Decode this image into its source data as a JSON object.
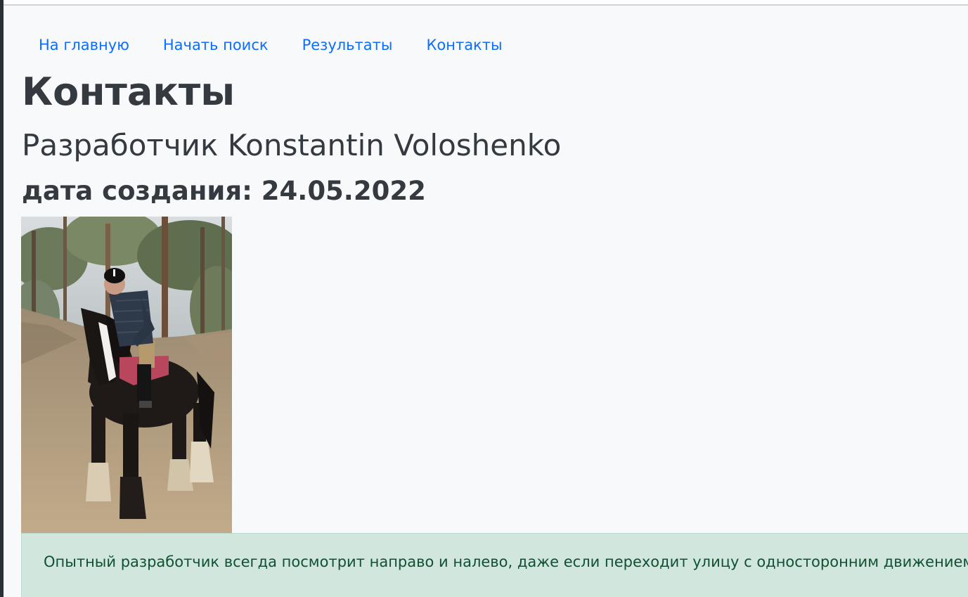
{
  "nav": {
    "items": [
      {
        "label": "На главную"
      },
      {
        "label": "Начать поиск"
      },
      {
        "label": "Результаты"
      },
      {
        "label": "Контакты"
      }
    ]
  },
  "page": {
    "title": "Контакты",
    "developer": "Разработчик Konstantin Voloshenko",
    "created": "дата создания: 24.05.2022"
  },
  "photo": {
    "subject": "rider-on-horse-photo"
  },
  "alert": {
    "text": "Опытный разработчик всегда посмотрит направо и налево, даже если переходит улицу с односторонним движением"
  },
  "colors": {
    "link": "#0d6efd",
    "heading": "#343a40",
    "background": "#f8f9fa",
    "alert_bg": "#d1e7dd",
    "alert_text": "#0f5132"
  }
}
